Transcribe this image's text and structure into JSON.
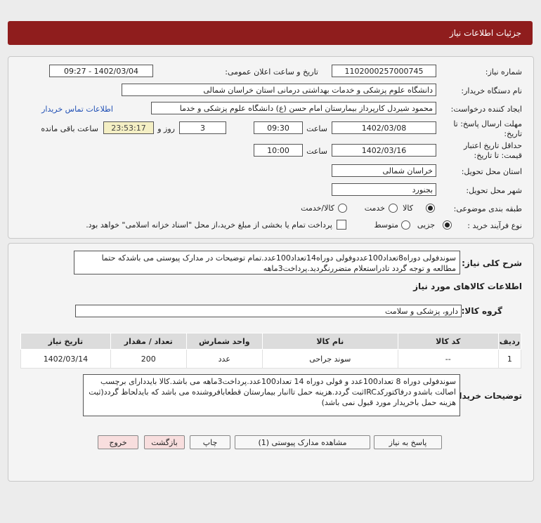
{
  "header": {
    "title": "جزئیات اطلاعات نیاز"
  },
  "form": {
    "need_number_label": "شماره نیاز:",
    "need_number": "1102000257000745",
    "announce_label": "تاریخ و ساعت اعلان عمومی:",
    "announce_value": "1402/03/04 - 09:27",
    "buyer_org_label": "نام دستگاه خریدار:",
    "buyer_org": "دانشگاه علوم پزشکی و خدمات بهداشتی درمانی استان خراسان شمالی",
    "creator_label": "ایجاد کننده درخواست:",
    "creator": "محمود شیردل کارپرداز بیمارستان امام حسن (ع) دانشگاه علوم پزشکی و خدما",
    "contact_link": "اطلاعات تماس خریدار",
    "reply_deadline_label_1": "مهلت ارسال پاسخ: تا",
    "reply_deadline_label_2": "تاریخ:",
    "reply_date": "1402/03/08",
    "time_label": "ساعت",
    "reply_time": "09:30",
    "days": "3",
    "days_label": "روز و",
    "remaining": "23:53:17",
    "remaining_label": "ساعت باقی مانده",
    "validity_label_1": "حداقل تاریخ اعتبار",
    "validity_label_2": "قیمت: تا تاریخ:",
    "validity_date": "1402/03/16",
    "validity_time": "10:00",
    "province_label": "استان محل تحویل:",
    "province": "خراسان شمالی",
    "city_label": "شهر محل تحویل:",
    "city": "بجنورد",
    "category_label": "طبقه بندی موضوعی:",
    "category_options": [
      "کالا",
      "خدمت",
      "کالا/خدمت"
    ],
    "purchase_type_label": "نوع فرآیند خرید :",
    "purchase_options": [
      "جزیی",
      "متوسط"
    ],
    "payment_note": "پرداخت تمام یا بخشی از مبلغ خرید،از محل \"اسناد خزانه اسلامی\" خواهد بود."
  },
  "summary": {
    "label": "شرح کلی نیاز:",
    "text": "سوندفولی دوراه8تعداد100عددوفولی دوراه14تعداد100عدد.تمام توضیحات در مدارک پیوستی می باشدکه حتما مطالعه و توجه گردد تادراستعلام متضررنگردید.پرداخت3ماهه"
  },
  "goods": {
    "section_title": "اطلاعات کالاهای مورد نیاز",
    "group_label": "گروه کالا:",
    "group_value": "دارو، پزشکی و سلامت",
    "columns": [
      "ردیف",
      "کد کالا",
      "نام کالا",
      "واحد شمارش",
      "تعداد / مقدار",
      "تاریخ نیاز"
    ],
    "rows": [
      [
        "1",
        "--",
        "سوند جراحی",
        "عدد",
        "200",
        "1402/03/14"
      ]
    ]
  },
  "buyer_notes": {
    "label": "توضیحات خریدار:",
    "text": "سوندفولی دوراه 8 تعداد100عدد و فولی دوراه 14 تعداد100عدد.پرداخت3ماهه می باشد.کالا بایددارای برچسب اصالت باشدو درفاکتورکدIRCثبت گردد.هزینه حمل تاانبار بیمارستان قطعابافروشنده می باشد که بایدلحاظ گردد(ثبت هزینه حمل باخریدار مورد قبول نمی باشد)"
  },
  "buttons": {
    "reply": "پاسخ به نیاز",
    "view_docs": "مشاهده مدارک پیوستی (1)",
    "print": "چاپ",
    "back": "بازگشت",
    "exit": "خروج"
  }
}
